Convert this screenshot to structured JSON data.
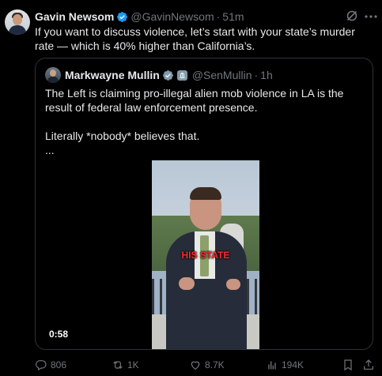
{
  "tweet": {
    "author_name": "Gavin Newsom",
    "author_handle": "@GavinNewsom",
    "separator": "·",
    "time": "51m",
    "text": "If you want to discuss violence, let’s start with your state’s murder rate — which is 40% higher than California’s."
  },
  "quote": {
    "author_name": "Markwayne Mullin",
    "author_handle": "@SenMullin",
    "separator": "·",
    "time": "1h",
    "line1": "The Left is claiming pro-illegal alien mob violence in LA is the result of federal law enforcement presence.",
    "line2": "Literally *nobody* believes that.",
    "line3": "...",
    "video": {
      "caption": "HIS STATE",
      "duration": "0:58"
    }
  },
  "actions": {
    "replies": "806",
    "reposts": "1K",
    "likes": "8.7K",
    "views": "194K"
  },
  "colors": {
    "background": "#000000",
    "text": "#e7e9ea",
    "muted": "#71767b",
    "verified": "#1d9bf0",
    "border": "#2f3336"
  }
}
